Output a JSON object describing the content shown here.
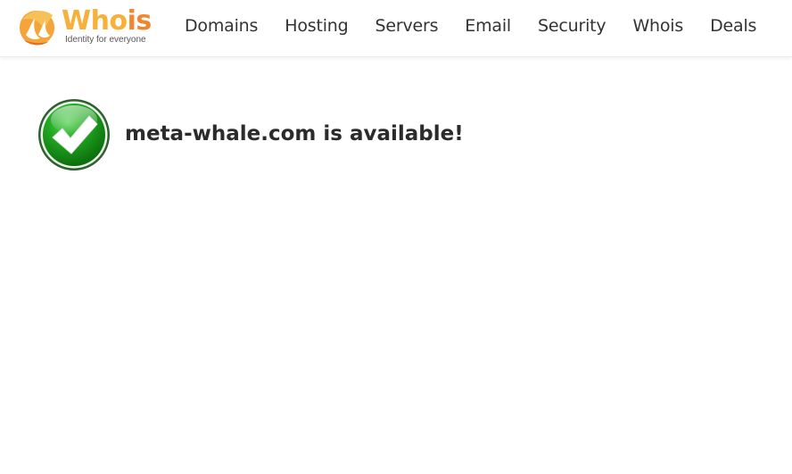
{
  "header": {
    "logo": {
      "word_part1": "Who",
      "word_part2": "is",
      "tagline": "Identity for everyone",
      "icon": "whois-logo-icon"
    },
    "nav": [
      {
        "label": "Domains"
      },
      {
        "label": "Hosting"
      },
      {
        "label": "Servers"
      },
      {
        "label": "Email"
      },
      {
        "label": "Security"
      },
      {
        "label": "Whois"
      },
      {
        "label": "Deals"
      }
    ]
  },
  "result": {
    "icon": "checkmark-icon",
    "message": "meta-whale.com is available!"
  },
  "colors": {
    "brand_yellow": "#f7b13a",
    "brand_orange": "#f0862f",
    "success_green": "#1e9a1e",
    "text": "#2b2b2b"
  }
}
